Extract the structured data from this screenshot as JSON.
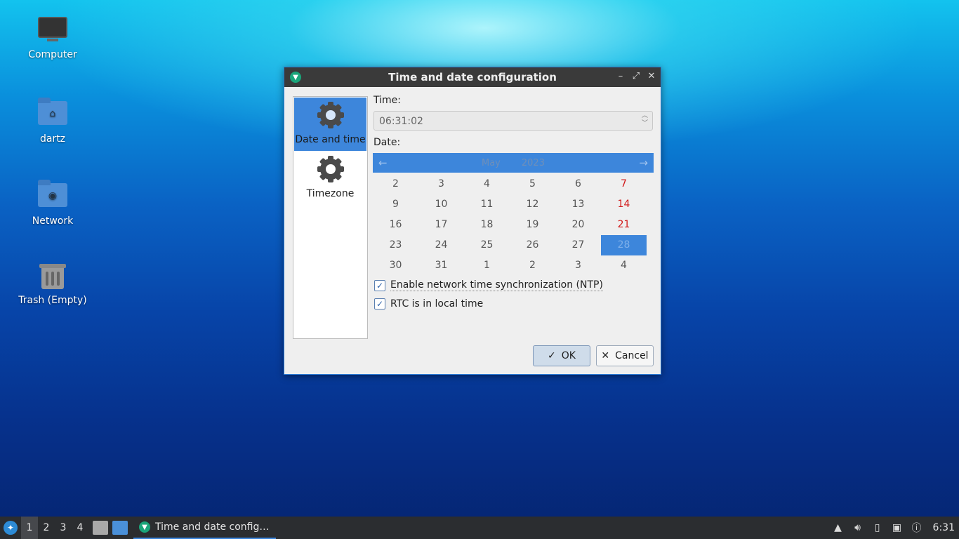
{
  "desktop": {
    "icons": [
      {
        "label": "Computer"
      },
      {
        "label": "dartz"
      },
      {
        "label": "Network"
      },
      {
        "label": "Trash (Empty)"
      }
    ]
  },
  "dialog": {
    "title": "Time and date configuration",
    "sidebar": [
      {
        "label": "Date and time",
        "icon": "gear-icon",
        "active": true
      },
      {
        "label": "Timezone",
        "icon": "gear-icon",
        "active": false
      }
    ],
    "time_label": "Time:",
    "time_value": "06:31:02",
    "date_label": "Date:",
    "calendar": {
      "month": "May",
      "year": "2023",
      "selected_day": "28",
      "weeks": [
        [
          "2",
          "3",
          "4",
          "5",
          "6",
          "7"
        ],
        [
          "9",
          "10",
          "11",
          "12",
          "13",
          "14"
        ],
        [
          "16",
          "17",
          "18",
          "19",
          "20",
          "21"
        ],
        [
          "23",
          "24",
          "25",
          "26",
          "27",
          "28"
        ],
        [
          "30",
          "31",
          "1",
          "2",
          "3",
          "4"
        ]
      ]
    },
    "ntp_label": "Enable network time synchronization (NTP)",
    "ntp_checked": true,
    "rtc_label": "RTC is in local time",
    "rtc_checked": true,
    "ok_label": "OK",
    "cancel_label": "Cancel"
  },
  "taskbar": {
    "workspaces": [
      "1",
      "2",
      "3",
      "4"
    ],
    "active_workspace": "1",
    "task_label": "Time and date config…",
    "clock": "6:31"
  },
  "colors": {
    "accent": "#3d86db",
    "weekend": "#d11818",
    "titlebar": "#3a3a3a",
    "taskbar": "#2b2d30"
  }
}
